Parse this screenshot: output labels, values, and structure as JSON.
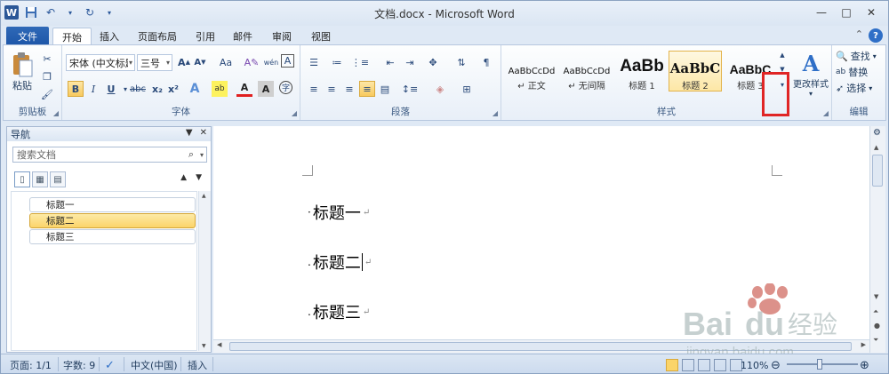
{
  "window": {
    "title": "文档.docx - Microsoft Word",
    "icons": [
      "word-logo-icon",
      "save-icon",
      "undo-icon",
      "redo-icon",
      "customize-qat-icon",
      "minimize-icon",
      "maximize-icon",
      "close-icon"
    ]
  },
  "tabs": [
    {
      "label": "文件"
    },
    {
      "label": "开始"
    },
    {
      "label": "插入"
    },
    {
      "label": "页面布局"
    },
    {
      "label": "引用"
    },
    {
      "label": "邮件"
    },
    {
      "label": "审阅"
    },
    {
      "label": "视图"
    }
  ],
  "ribbon": {
    "clipboard": {
      "paste_label": "粘贴",
      "group_label": "剪贴板"
    },
    "font": {
      "font_name": "宋体 (中文标题",
      "font_size": "三号",
      "group_label": "字体",
      "bold": "B",
      "italic": "I",
      "underline": "U",
      "strike": "abc",
      "sub": "x₂",
      "sup": "x²",
      "grow": "A",
      "shrink": "A",
      "case": "Aa",
      "clear": "A",
      "phonetic": "wén",
      "char_border": "A",
      "color_a": "A",
      "char_shade": "A",
      "enclose": "字"
    },
    "paragraph": {
      "group_label": "段落"
    },
    "styles": {
      "group_label": "样式",
      "items": [
        {
          "sample": "AaBbCcDd",
          "name": "↵ 正文"
        },
        {
          "sample": "AaBbCcDd",
          "name": "↵ 无间隔"
        },
        {
          "sample": "AaBb",
          "name": "标题 1"
        },
        {
          "sample": "AaBbC",
          "name": "标题 2"
        },
        {
          "sample": "AaBbC",
          "name": "标题 3"
        }
      ],
      "change_styles": "更改样式"
    },
    "editing": {
      "group_label": "编辑",
      "find": "查找",
      "replace": "替换",
      "select": "选择"
    }
  },
  "nav": {
    "title": "导航",
    "search_placeholder": "搜索文档",
    "headings": [
      "标题一",
      "标题二",
      "标题三"
    ],
    "selected": "标题二"
  },
  "document": {
    "paragraphs": [
      "标题一",
      "标题二",
      "标题三"
    ],
    "para_mark": "↵"
  },
  "status": {
    "page": "页面: 1/1",
    "words": "字数: 9",
    "language": "中文(中国)",
    "mode": "插入",
    "zoom": "110%"
  },
  "watermark": {
    "text": "Baidu经验",
    "sub": "jingyan.baidu.com"
  },
  "colors": {
    "accent": "#2b579a",
    "highlight": "#fbd46a",
    "red_box": "#e02525"
  }
}
